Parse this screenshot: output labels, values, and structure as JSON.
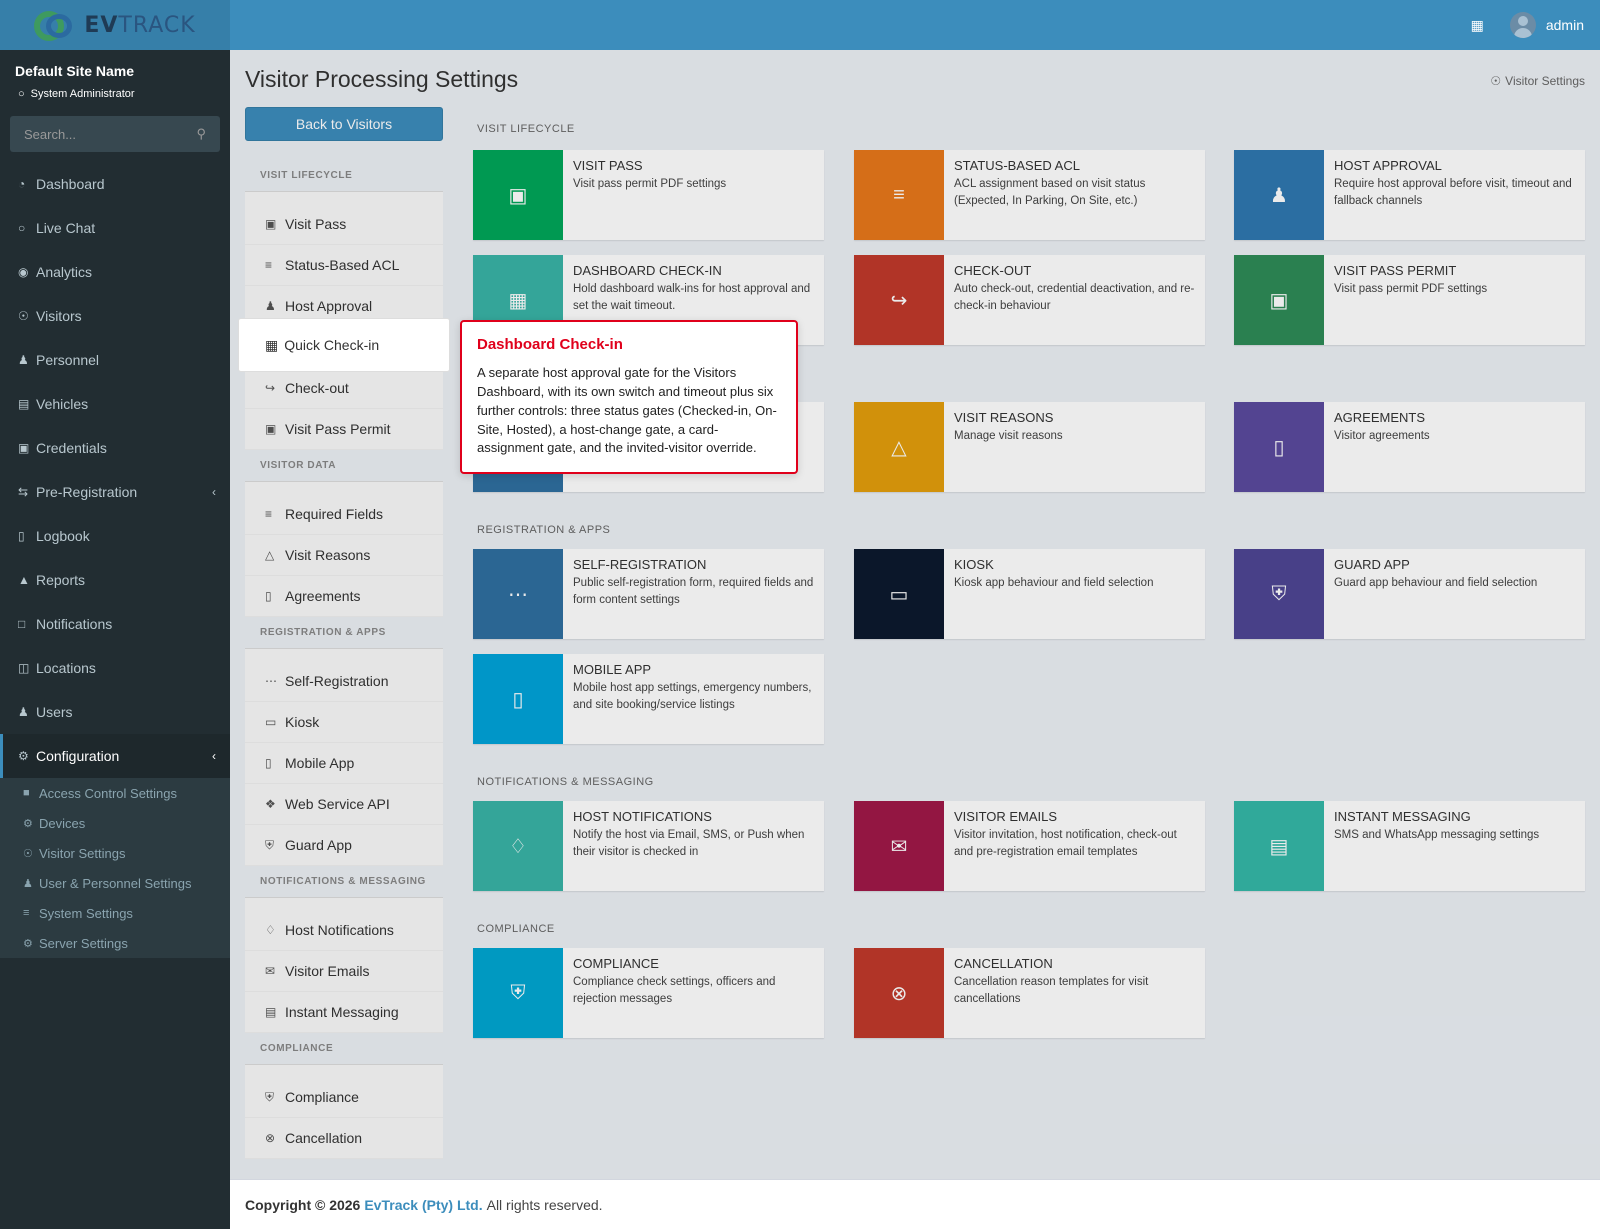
{
  "app": {
    "brand_a": "EV",
    "brand_b": "TRACK",
    "user": "admin"
  },
  "colors": {
    "header": "#3c8dbc",
    "sidebar": "#222d32",
    "tooltip_border": "#e0001b"
  },
  "sidebar": {
    "site_name": "Default Site Name",
    "role": "System Administrator",
    "search_placeholder": "Search...",
    "items": [
      {
        "label": "Dashboard",
        "icon": "speedometer-icon"
      },
      {
        "label": "Live Chat",
        "icon": "headset-icon"
      },
      {
        "label": "Analytics",
        "icon": "analytics-icon"
      },
      {
        "label": "Visitors",
        "icon": "eye-icon"
      },
      {
        "label": "Personnel",
        "icon": "person-icon"
      },
      {
        "label": "Vehicles",
        "icon": "car-icon"
      },
      {
        "label": "Credentials",
        "icon": "id-card-icon"
      },
      {
        "label": "Pre-Registration",
        "icon": "arrows-icon"
      },
      {
        "label": "Logbook",
        "icon": "book-icon"
      },
      {
        "label": "Reports",
        "icon": "chart-icon"
      },
      {
        "label": "Notifications",
        "icon": "chat-icon"
      },
      {
        "label": "Locations",
        "icon": "map-icon"
      },
      {
        "label": "Users",
        "icon": "user-icon"
      },
      {
        "label": "Configuration",
        "icon": "gear-icon"
      }
    ],
    "sub_items": [
      {
        "label": "Access Control Settings",
        "icon": "lock-icon"
      },
      {
        "label": "Devices",
        "icon": "device-icon"
      },
      {
        "label": "Visitor Settings",
        "icon": "eye-icon"
      },
      {
        "label": "User & Personnel Settings",
        "icon": "user-gear-icon"
      },
      {
        "label": "System Settings",
        "icon": "sliders-icon"
      },
      {
        "label": "Server Settings",
        "icon": "server-icon"
      }
    ]
  },
  "main": {
    "title": "Visitor Processing Settings",
    "breadcrumb": "Visitor Settings",
    "back_button": "Back to Visitors",
    "nav_groups": [
      {
        "header": "VISIT LIFECYCLE",
        "items": [
          "Visit Pass",
          "Status-Based ACL",
          "Host Approval",
          "Quick Check-in",
          "Check-out",
          "Visit Pass Permit"
        ]
      },
      {
        "header": "VISITOR DATA",
        "items": [
          "Required Fields",
          "Visit Reasons",
          "Agreements"
        ]
      },
      {
        "header": "REGISTRATION & APPS",
        "items": [
          "Self-Registration",
          "Kiosk",
          "Mobile App",
          "Web Service API",
          "Guard App"
        ]
      },
      {
        "header": "NOTIFICATIONS & MESSAGING",
        "items": [
          "Host Notifications",
          "Visitor Emails",
          "Instant Messaging"
        ]
      },
      {
        "header": "COMPLIANCE",
        "items": [
          "Compliance",
          "Cancellation"
        ]
      }
    ],
    "sections": [
      "VISIT LIFECYCLE",
      "REGISTRATION & APPS",
      "NOTIFICATIONS & MESSAGING",
      "COMPLIANCE"
    ],
    "cards": [
      {
        "title": "VISIT PASS",
        "desc": "Visit pass permit PDF settings",
        "color": "#00a65a",
        "icon": "ticket-icon"
      },
      {
        "title": "STATUS-BASED ACL",
        "desc": "ACL assignment based on visit status (Expected, In Parking, On Site, etc.)",
        "color": "#e8781b",
        "icon": "checklist-icon"
      },
      {
        "title": "HOST APPROVAL",
        "desc": "Require host approval before visit, timeout and fallback channels",
        "color": "#2f78b0",
        "icon": "user-check-icon"
      },
      {
        "title": "DASHBOARD CHECK-IN",
        "desc": "Hold dashboard walk-ins for host approval and set the wait timeout.",
        "color": "#39b3a7",
        "icon": "door-icon"
      },
      {
        "title": "CHECK-OUT",
        "desc": "Auto check-out, credential deactivation, and re-check-in behaviour",
        "color": "#c0392b",
        "icon": "logout-icon"
      },
      {
        "title": "VISIT PASS PERMIT",
        "desc": "Visit pass permit PDF settings",
        "color": "#2e8b57",
        "icon": "badge-icon"
      },
      {
        "title": "VISIT REASONS",
        "desc": "Manage visit reasons",
        "color": "#e39e0d",
        "icon": "shapes-icon"
      },
      {
        "title": "AGREEMENTS",
        "desc": "Visitor agreements",
        "color": "#5b4a9e",
        "icon": "document-icon"
      },
      {
        "title": "SELF-REGISTRATION",
        "desc": "Public self-registration form, required fields and form content settings",
        "color": "#2f6fa0",
        "icon": "form-icon"
      },
      {
        "title": "KIOSK",
        "desc": "Kiosk app behaviour and field selection",
        "color": "#0d1a2e",
        "icon": "monitor-icon"
      },
      {
        "title": "GUARD APP",
        "desc": "Guard app behaviour and field selection",
        "color": "#4f4694",
        "icon": "shield-icon"
      },
      {
        "title": "MOBILE APP",
        "desc": "Mobile host app settings, emergency numbers, and site booking/service listings",
        "color": "#00a3d9",
        "icon": "phone-icon"
      },
      {
        "title": "HOST NOTIFICATIONS",
        "desc": "Notify the host via Email, SMS, or Push when their visitor is checked in",
        "color": "#39b3a7",
        "icon": "bell-icon"
      },
      {
        "title": "VISITOR EMAILS",
        "desc": "Visitor invitation, host notification, check-out and pre-registration email templates",
        "color": "#a01848",
        "icon": "mail-icon"
      },
      {
        "title": "INSTANT MESSAGING",
        "desc": "SMS and WhatsApp messaging settings",
        "color": "#35b8a8",
        "icon": "message-icon"
      },
      {
        "title": "COMPLIANCE",
        "desc": "Compliance check settings, officers and rejection messages",
        "color": "#00a7d2",
        "icon": "shield-search-icon"
      },
      {
        "title": "CANCELLATION",
        "desc": "Cancellation reason templates for visit cancellations",
        "color": "#c0392b",
        "icon": "x-circle-icon"
      }
    ]
  },
  "tooltip": {
    "title": "Dashboard Check-in",
    "text": "A separate host approval gate for the Visitors Dashboard, with its own switch and timeout plus six further controls: three status gates (Checked-in, On-Site, Hosted), a host-change gate, a card-assignment gate, and the invited-visitor override."
  },
  "footer": {
    "prefix": "Copyright © 2026",
    "company": "EvTrack (Pty) Ltd.",
    "suffix": "All rights reserved."
  }
}
